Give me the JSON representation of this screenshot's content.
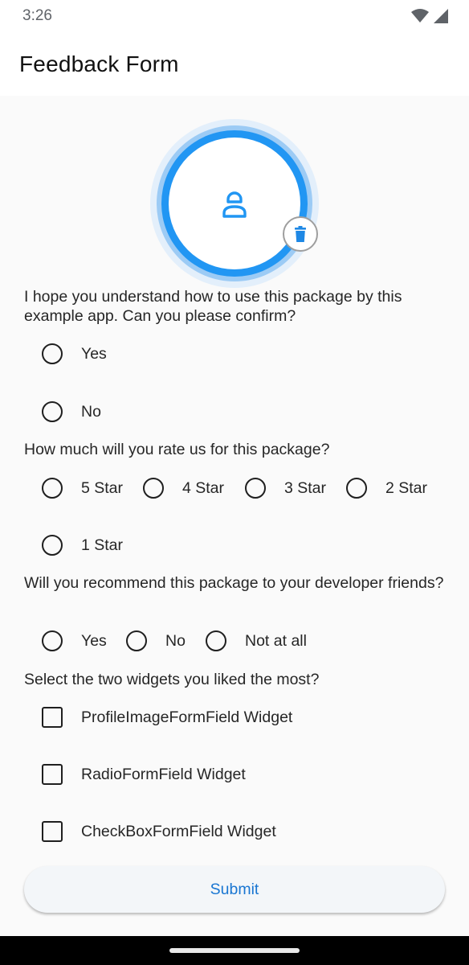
{
  "status_bar": {
    "time": "3:26",
    "icons": [
      "wifi-icon",
      "signal-icon"
    ]
  },
  "app_bar": {
    "title": "Feedback Form"
  },
  "avatar": {
    "icon": "person-icon",
    "delete_icon": "trash-icon",
    "accent": "#2196f3"
  },
  "questions": [
    {
      "text": "I hope you understand how to use this package by this example app. Can you please confirm?",
      "type": "radio",
      "options": [
        "Yes",
        "No"
      ]
    },
    {
      "text": "How much will you rate us for this package?",
      "type": "radio",
      "options": [
        "5 Star",
        "4 Star",
        "3 Star",
        "2 Star",
        "1 Star"
      ]
    },
    {
      "text": "Will you recommend this package to your developer friends?",
      "type": "radio",
      "options": [
        "Yes",
        "No",
        "Not at all"
      ]
    },
    {
      "text": "Select the two widgets you liked the most?",
      "type": "checkbox",
      "options": [
        "ProfileImageFormField Widget",
        "RadioFormField Widget",
        "CheckBoxFormField Widget"
      ]
    }
  ],
  "submit": {
    "label": "Submit",
    "color": "#1976d2"
  }
}
